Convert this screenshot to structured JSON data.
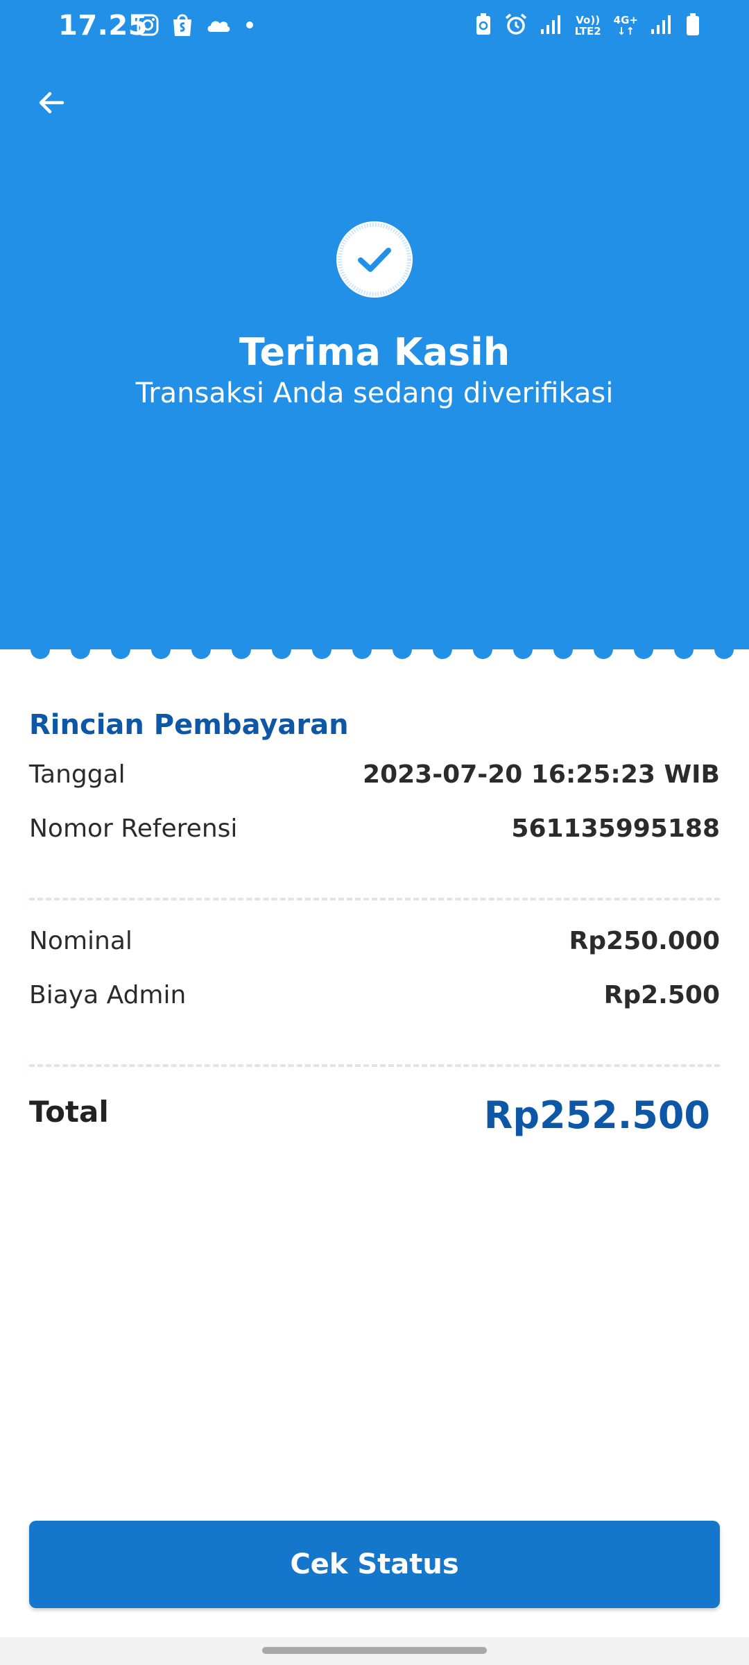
{
  "status_bar": {
    "time": "17.25",
    "network_label_top": "Vo))",
    "network_label_bottom": "LTE2",
    "network_type": "4G+"
  },
  "header": {
    "title": "Terima Kasih",
    "subtitle": "Transaksi Anda sedang diverifikasi"
  },
  "details": {
    "section_title": "Rincian Pembayaran",
    "rows": [
      {
        "label": "Tanggal",
        "value": "2023-07-20 16:25:23 WIB"
      },
      {
        "label": "Nomor Referensi",
        "value": "561135995188"
      },
      {
        "label": "Nominal",
        "value": "Rp250.000"
      },
      {
        "label": "Biaya Admin",
        "value": "Rp2.500"
      }
    ],
    "total_label": "Total",
    "total_value": "Rp252.500"
  },
  "actions": {
    "check_status_label": "Cek Status"
  },
  "colors": {
    "header_bg": "#2290e6",
    "accent_dark": "#0d57a6",
    "button_bg": "#1477cc"
  }
}
